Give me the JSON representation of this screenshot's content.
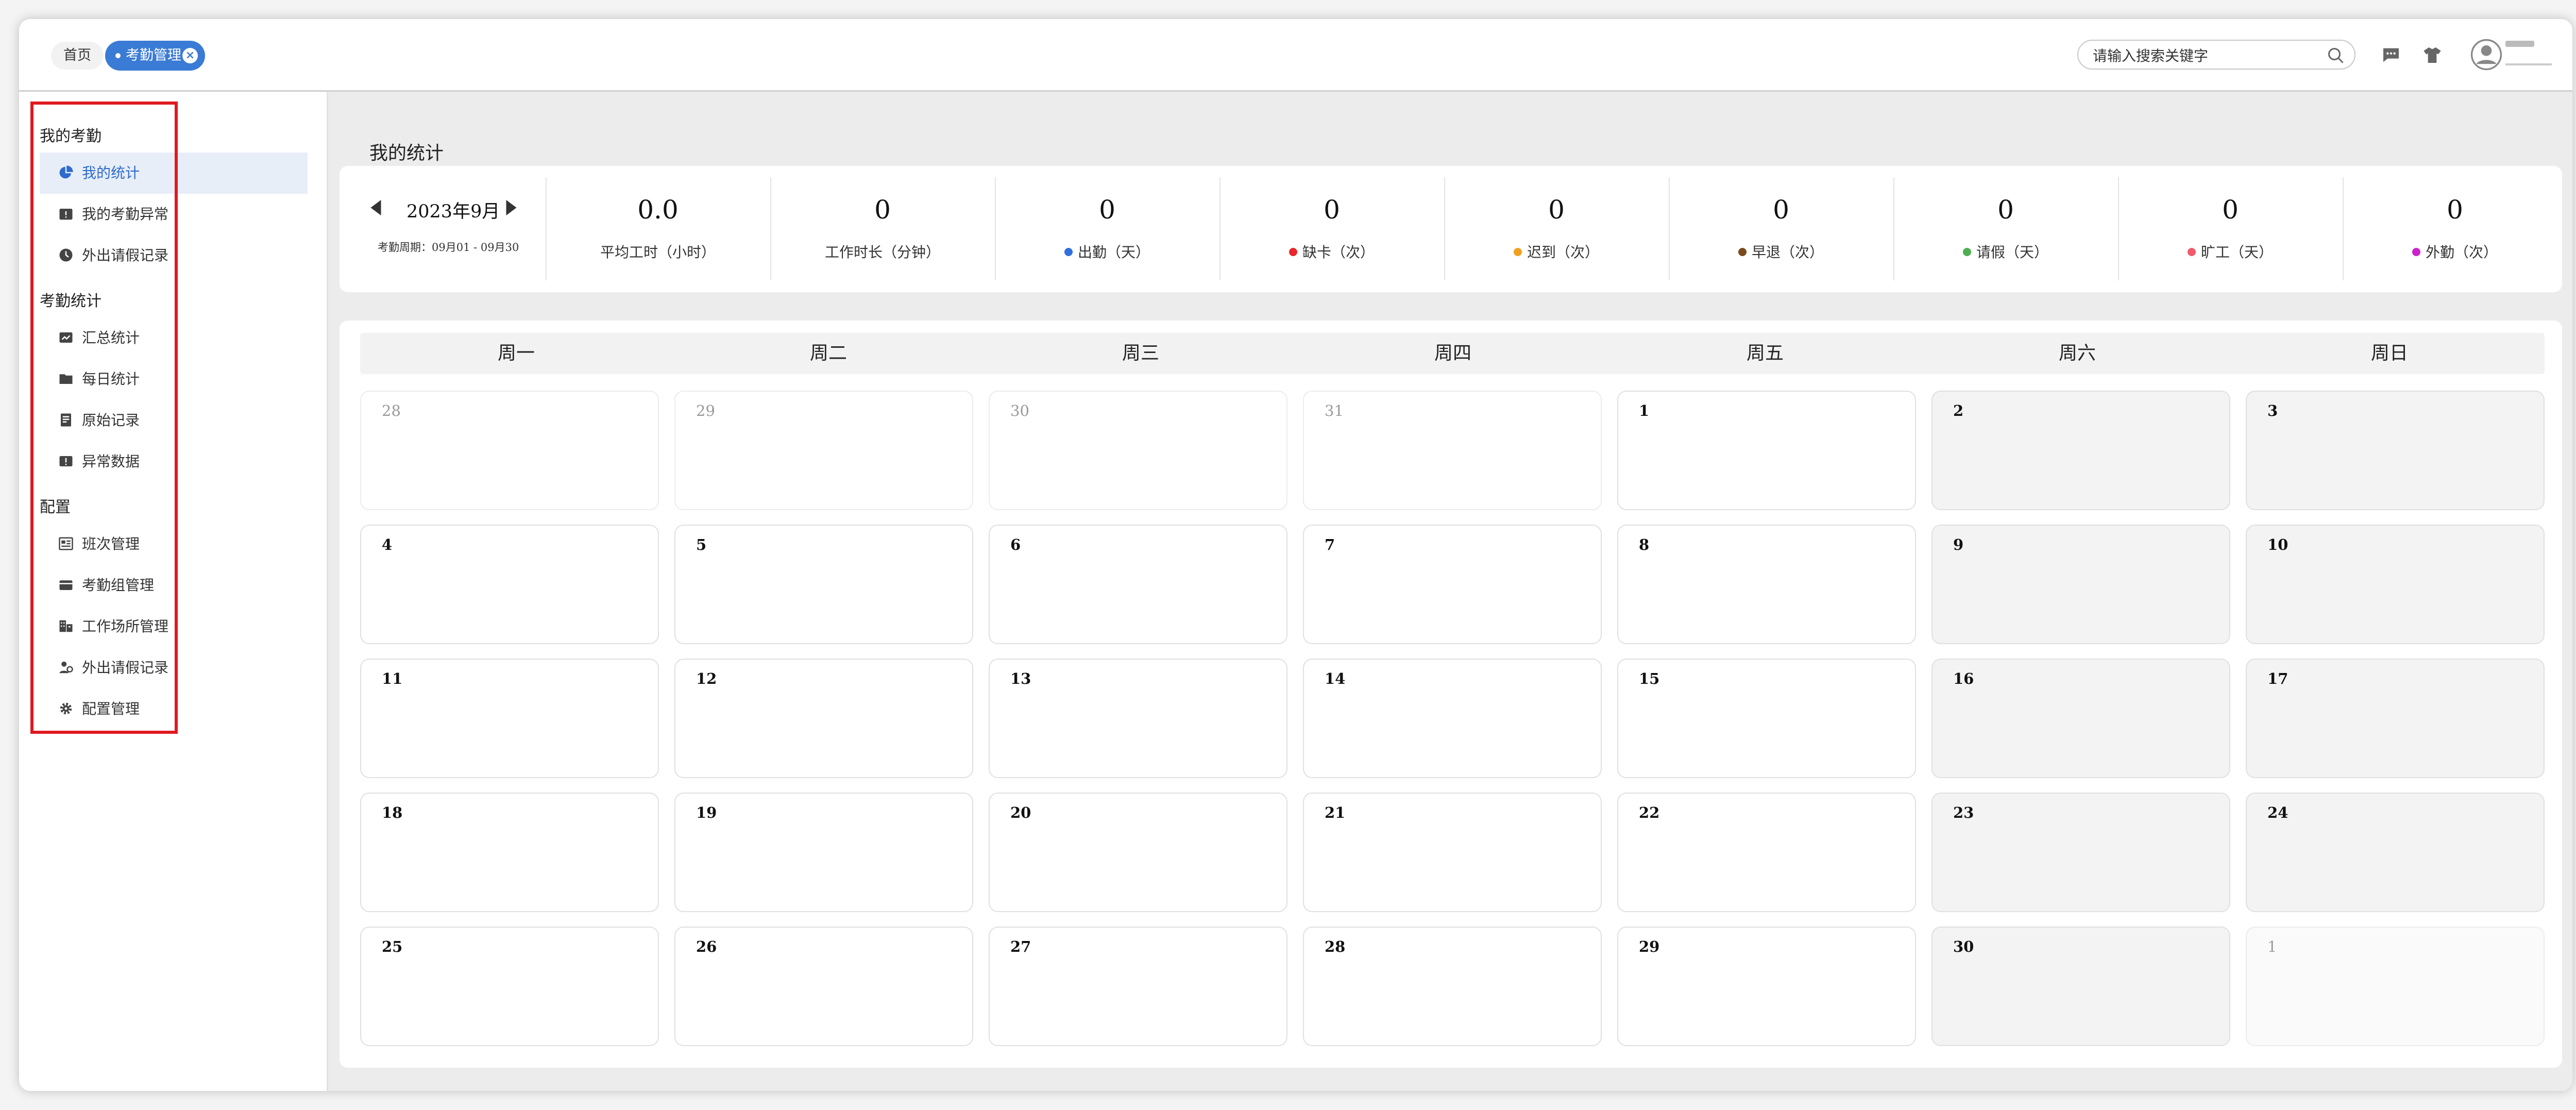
{
  "header": {
    "tabs": [
      {
        "label": "首页",
        "active": false
      },
      {
        "label": "考勤管理",
        "active": true
      }
    ],
    "search": {
      "placeholder": "请输入搜索关键字"
    },
    "icons": [
      "message-icon",
      "shirt-icon",
      "user-avatar-icon"
    ]
  },
  "sidebar": {
    "groups": [
      {
        "title": "我的考勤",
        "items": [
          {
            "label": "我的统计",
            "icon": "pie-chart-icon",
            "active": true
          },
          {
            "label": "我的考勤异常",
            "icon": "calendar-alert-icon"
          },
          {
            "label": "外出请假记录",
            "icon": "clock-icon"
          }
        ]
      },
      {
        "title": "考勤统计",
        "items": [
          {
            "label": "汇总统计",
            "icon": "chart-card-icon"
          },
          {
            "label": "每日统计",
            "icon": "folder-icon"
          },
          {
            "label": "原始记录",
            "icon": "document-icon"
          },
          {
            "label": "异常数据",
            "icon": "alert-card-icon"
          }
        ]
      },
      {
        "title": "配置",
        "items": [
          {
            "label": "班次管理",
            "icon": "schedule-icon"
          },
          {
            "label": "考勤组管理",
            "icon": "wallet-icon"
          },
          {
            "label": "工作场所管理",
            "icon": "building-icon"
          },
          {
            "label": "外出请假记录",
            "icon": "user-group-icon"
          },
          {
            "label": "配置管理",
            "icon": "gear-icon"
          }
        ]
      }
    ]
  },
  "main": {
    "title": "我的统计",
    "month": "2023年9月",
    "period": "考勤周期：09月01 - 09月30",
    "stats": [
      {
        "value": "0.0",
        "label": "平均工时（小时）",
        "color": null
      },
      {
        "value": "0",
        "label": "工作时长（分钟）",
        "color": null
      },
      {
        "value": "0",
        "label": "出勤（天）",
        "color": "#2f6fe0"
      },
      {
        "value": "0",
        "label": "缺卡（次）",
        "color": "#e8262b"
      },
      {
        "value": "0",
        "label": "迟到（次）",
        "color": "#f0a020"
      },
      {
        "value": "0",
        "label": "早退（次）",
        "color": "#7a4a1e"
      },
      {
        "value": "0",
        "label": "请假（天）",
        "color": "#4caf50"
      },
      {
        "value": "0",
        "label": "旷工（天）",
        "color": "#f05a6a"
      },
      {
        "value": "0",
        "label": "外勤（次）",
        "color": "#cc22cc"
      }
    ],
    "weekdays": [
      "周一",
      "周二",
      "周三",
      "周四",
      "周五",
      "周六",
      "周日"
    ],
    "weeks": [
      [
        {
          "d": "28",
          "o": true
        },
        {
          "d": "29",
          "o": true
        },
        {
          "d": "30",
          "o": true
        },
        {
          "d": "31",
          "o": true
        },
        {
          "d": "1"
        },
        {
          "d": "2"
        },
        {
          "d": "3"
        }
      ],
      [
        {
          "d": "4"
        },
        {
          "d": "5"
        },
        {
          "d": "6"
        },
        {
          "d": "7"
        },
        {
          "d": "8"
        },
        {
          "d": "9"
        },
        {
          "d": "10"
        }
      ],
      [
        {
          "d": "11"
        },
        {
          "d": "12"
        },
        {
          "d": "13"
        },
        {
          "d": "14"
        },
        {
          "d": "15"
        },
        {
          "d": "16"
        },
        {
          "d": "17"
        }
      ],
      [
        {
          "d": "18"
        },
        {
          "d": "19"
        },
        {
          "d": "20"
        },
        {
          "d": "21"
        },
        {
          "d": "22"
        },
        {
          "d": "23"
        },
        {
          "d": "24"
        }
      ],
      [
        {
          "d": "25"
        },
        {
          "d": "26"
        },
        {
          "d": "27"
        },
        {
          "d": "28"
        },
        {
          "d": "29"
        },
        {
          "d": "30"
        },
        {
          "d": "1",
          "o": true
        }
      ]
    ]
  },
  "colors": {
    "accent": "#3a7bd5",
    "highlight_box": "#e0191f",
    "active_bg": "#e8eef8"
  }
}
